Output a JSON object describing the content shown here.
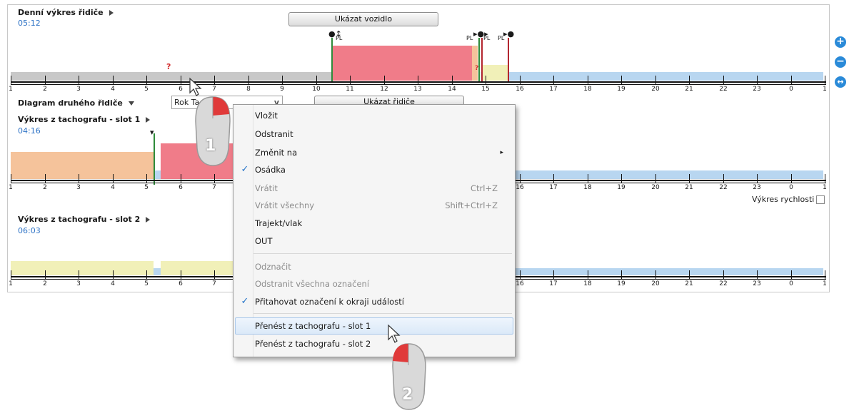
{
  "daily_chart": {
    "title": "Denní výkres řidiče",
    "time": "05:12",
    "show_vehicle": "Ukázat vozidlo",
    "question_mark": "?"
  },
  "markers": {
    "pl": "PL"
  },
  "driver2": {
    "label": "Diagram druhého řidiče",
    "select_value": "Rok Ta",
    "select_arrow": "v",
    "show_driver": "Ukázat řidiče"
  },
  "slot1": {
    "title": "Výkres z tachografu - slot 1",
    "time": "04:16"
  },
  "slot2": {
    "title": "Výkres z tachografu - slot 2",
    "time": "06:03"
  },
  "speed_chart": {
    "label": "Výkres rychlosti"
  },
  "axis_hours": [
    "1",
    "2",
    "3",
    "4",
    "5",
    "6",
    "7",
    "8",
    "9",
    "10",
    "11",
    "12",
    "13",
    "14",
    "15",
    "16",
    "17",
    "18",
    "19",
    "20",
    "21",
    "22",
    "23",
    "0",
    "1"
  ],
  "zoom": {
    "in": "+",
    "out": "−",
    "fit": "↔"
  },
  "context_menu": {
    "items": [
      {
        "label": "Vložit",
        "enabled": true
      },
      {
        "label": "Odstranit",
        "enabled": true
      },
      {
        "label": "Změnit na",
        "enabled": true,
        "submenu": "▸"
      },
      {
        "label": "Osádka",
        "enabled": true,
        "checked": "✓"
      },
      {
        "label": "Vrátit",
        "enabled": false,
        "shortcut": "Ctrl+Z"
      },
      {
        "label": "Vrátit všechny",
        "enabled": false,
        "shortcut": "Shift+Ctrl+Z"
      },
      {
        "label": "Trajekt/vlak",
        "enabled": true
      },
      {
        "label": "OUT",
        "enabled": true
      },
      {
        "label": "Odznačit",
        "enabled": false
      },
      {
        "label": "Odstranit všechna označení",
        "enabled": false
      },
      {
        "label": "Přitahovat označení k okraji událostí",
        "enabled": true,
        "checked": "✓"
      },
      {
        "label": "Přenést z tachografu - slot 1",
        "enabled": true,
        "highlighted": true
      },
      {
        "label": "Přenést z tachografu - slot 2",
        "enabled": true
      }
    ]
  },
  "callouts": {
    "step1": "1",
    "step2": "2"
  },
  "colors": {
    "rest": "#c8c8c8",
    "driving": "#f07c89",
    "work": "#f5c39b",
    "availability": "#b8d6f0",
    "unknown": "#f1f0b8",
    "accent": "#2a8ad8"
  }
}
